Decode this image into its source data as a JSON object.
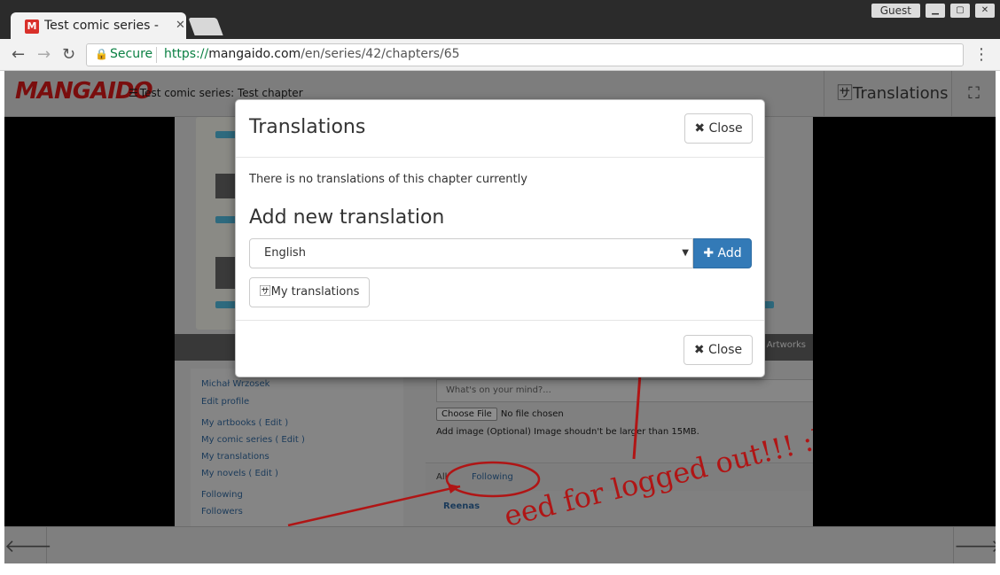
{
  "browser": {
    "tab_title": "Test comic series - T",
    "tab_favicon": "M",
    "secure_label": "Secure",
    "url_scheme": "https://",
    "url_host": "mangaido.com",
    "url_path": "/en/series/42/chapters/65",
    "guest_label": "Guest"
  },
  "app": {
    "logo": "MANGAIDO",
    "chapter_title": "Test comic series: Test chapter",
    "translations_label": "Translations"
  },
  "background": {
    "artworks": "Artworks",
    "user_name": "Michał Wrzosek",
    "edit_profile": "Edit profile",
    "my_artbooks": "My artbooks ( Edit )",
    "my_comic_series": "My comic series ( Edit )",
    "my_translations": "My translations",
    "my_novels": "My novels ( Edit )",
    "following": "Following",
    "followers": "Followers",
    "mind_placeholder": "What's on your mind?...",
    "choose_file": "Choose File",
    "no_file": "No file chosen",
    "add_image": "Add image (Optional) Image shoudn't be larger than 15MB.",
    "tab_all": "All",
    "tab_following": "Following",
    "reenas": "Reenas",
    "annotation": "eed for logged out!!! :D",
    "annotation_color": "#b01515"
  },
  "modal": {
    "title": "Translations",
    "close_label": "Close",
    "no_translations": "There is no translations of this chapter currently",
    "add_heading": "Add new translation",
    "language_selected": "English",
    "add_label": "Add",
    "my_translations_label": "My translations",
    "accent_color": "#337ab7"
  }
}
